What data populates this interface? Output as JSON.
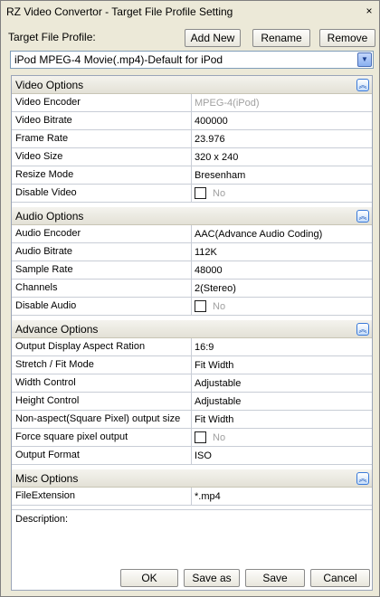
{
  "window": {
    "title": "RZ Video Convertor - Target File Profile Setting",
    "close_glyph": "×"
  },
  "profile": {
    "label": "Target File Profile:",
    "add_label": "Add New",
    "rename_label": "Rename",
    "remove_label": "Remove",
    "selected": "iPod MPEG-4 Movie(.mp4)-Default for iPod",
    "dropdown_glyph": "▼"
  },
  "sections": {
    "video": {
      "title": "Video Options",
      "collapse_glyph": "︽",
      "rows": [
        {
          "key": "Video Encoder",
          "value": "MPEG-4(iPod)"
        },
        {
          "key": "Video Bitrate",
          "value": "400000"
        },
        {
          "key": "Frame Rate",
          "value": "23.976"
        },
        {
          "key": "Video Size",
          "value": "320 x 240"
        },
        {
          "key": "Resize Mode",
          "value": "Bresenham"
        },
        {
          "key": "Disable Video",
          "value": "No"
        }
      ]
    },
    "audio": {
      "title": "Audio Options",
      "collapse_glyph": "︽",
      "rows": [
        {
          "key": "Audio Encoder",
          "value": "AAC(Advance Audio Coding)"
        },
        {
          "key": "Audio Bitrate",
          "value": "112K"
        },
        {
          "key": "Sample Rate",
          "value": "48000"
        },
        {
          "key": "Channels",
          "value": "2(Stereo)"
        },
        {
          "key": "Disable Audio",
          "value": "No"
        }
      ]
    },
    "advance": {
      "title": "Advance Options",
      "collapse_glyph": "︽",
      "rows": [
        {
          "key": "Output Display Aspect Ration",
          "value": "16:9"
        },
        {
          "key": "Stretch / Fit Mode",
          "value": "Fit Width"
        },
        {
          "key": "Width Control",
          "value": "Adjustable"
        },
        {
          "key": "Height Control",
          "value": "Adjustable"
        },
        {
          "key": "Non-aspect(Square Pixel) output size",
          "value": "Fit Width"
        },
        {
          "key": "Force square pixel output",
          "value": "No"
        },
        {
          "key": "Output Format",
          "value": "ISO"
        }
      ]
    },
    "misc": {
      "title": "Misc Options",
      "collapse_glyph": "︽",
      "rows": [
        {
          "key": "FileExtension",
          "value": "*.mp4"
        }
      ]
    }
  },
  "description": {
    "label": "Description:"
  },
  "footer": {
    "ok_label": "OK",
    "save_as_label": "Save as",
    "save_label": "Save",
    "cancel_label": "Cancel"
  }
}
